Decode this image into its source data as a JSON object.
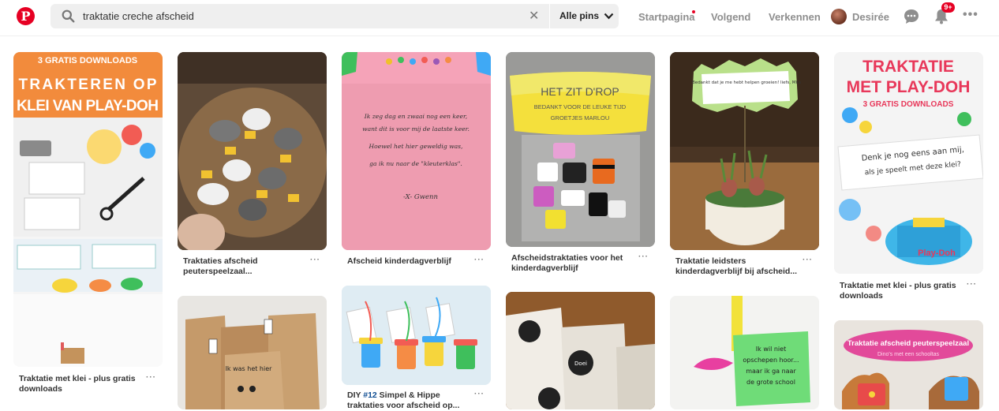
{
  "header": {
    "logo_letter": "P",
    "search_query": "traktatie creche afscheid",
    "search_scope": "Alle pins",
    "nav": {
      "home": "Startpagina",
      "following": "Volgend",
      "explore": "Verkennen"
    },
    "user_name": "Desirée",
    "notification_badge": "9+",
    "brand_color": "#e60023"
  },
  "pins": [
    {
      "title": "Traktatie met klei - plus gratis downloads",
      "banner_top": "3 GRATIS DOWNLOADS",
      "banner_main": "TRAKTEREN OP KLEI VAN PLAY-DOH"
    },
    {
      "title": "Traktaties afscheid peuterspeelzaal..."
    },
    {
      "title": "Afscheid kinderdagverblijf",
      "card_lines": [
        "Ik zeg dag en zwaai nog een keer,",
        "want dit is voor mij de laatste keer.",
        "Hoewel het hier geweldig was,",
        "ga ik nu naar de \"kleuterklas\".",
        "-X- Gwenn"
      ]
    },
    {
      "title": "Afscheidstraktaties voor het kinderdagverblijf",
      "label_line1": "HET ZIT D'ROP",
      "label_line2": "BEDANKT VOOR DE LEUKE TIJD",
      "label_line3": "GROETJES MARLOU"
    },
    {
      "title": "Traktatie leidsters kinderdagverblijf bij afscheid...",
      "card_text": "Bedankt dat je me hebt helpen groeien! liefs, Mila"
    },
    {
      "title": "Traktatie met klei - plus gratis downloads",
      "banner_main": "TRAKTATIE MET PLAY-DOH",
      "banner_sub": "3 GRATIS DOWNLOADS",
      "card_text": "Denk je nog eens aan mij, als je speelt met deze klei?"
    },
    {
      "title_prefix": "DIY ",
      "title_hash": "#12",
      "title_rest": " Simpel & Hippe traktaties voor afscheid op..."
    },
    {
      "bag_text": "Ik was het hier"
    },
    {
      "tag_text": "Doei"
    },
    {
      "note_text": "Ik wil niet opschepen hoor... maar ik ga naar de grote school"
    },
    {
      "banner_title": "Traktatie afscheid peuterspeelzaal",
      "banner_sub": "Dino's met een schooltas"
    }
  ],
  "more_label": "···"
}
